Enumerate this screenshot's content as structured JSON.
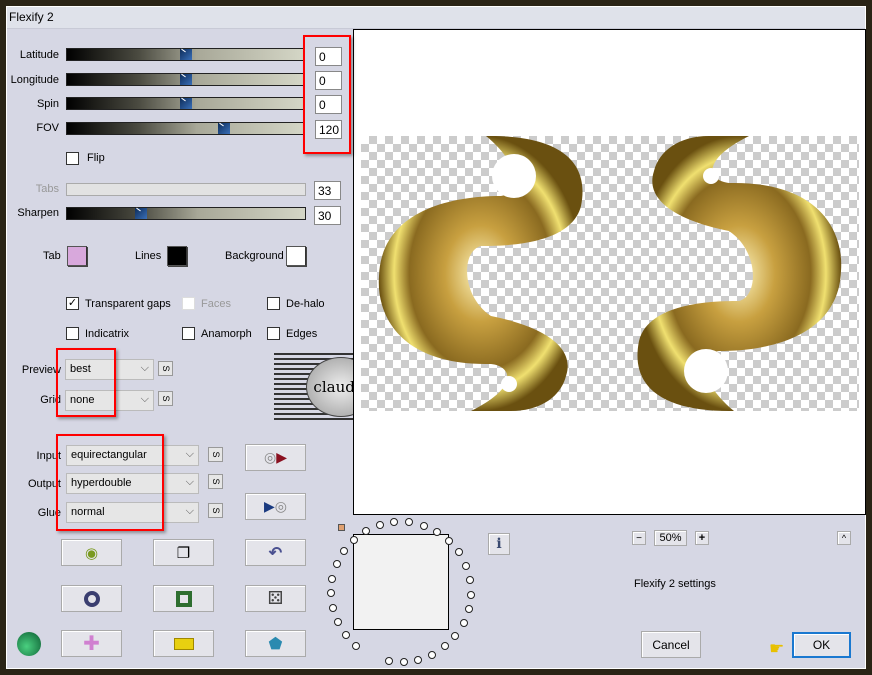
{
  "window": {
    "title": "Flexify 2"
  },
  "sliders": [
    {
      "label": "Latitude",
      "value": "0",
      "fraction": 0.5
    },
    {
      "label": "Longitude",
      "value": "0",
      "fraction": 0.5
    },
    {
      "label": "Spin",
      "value": "0",
      "fraction": 0.5
    },
    {
      "label": "FOV",
      "value": "120",
      "fraction": 0.66
    }
  ],
  "flip": {
    "label": "Flip",
    "checked": false
  },
  "tabs": {
    "label": "Tabs",
    "value": "33",
    "disabled": true
  },
  "sharpen": {
    "label": "Sharpen",
    "value": "30",
    "fraction": 0.3
  },
  "colors": {
    "tab_label": "Tab",
    "tab": "#d8a8dc",
    "lines_label": "Lines",
    "lines": "#000000",
    "background_label": "Background",
    "background": "#ffffff"
  },
  "options": {
    "transparent_gaps": {
      "label": "Transparent gaps",
      "checked": true
    },
    "faces": {
      "label": "Faces",
      "checked": false,
      "disabled": true
    },
    "dehalo": {
      "label": "De-halo",
      "checked": false
    },
    "indicatrix": {
      "label": "Indicatrix",
      "checked": false
    },
    "anamorph": {
      "label": "Anamorph",
      "checked": false
    },
    "edges": {
      "label": "Edges",
      "checked": false
    }
  },
  "preview_select": {
    "label": "Preview",
    "value": "best"
  },
  "grid_select": {
    "label": "Grid",
    "value": "none"
  },
  "input_select": {
    "label": "Input",
    "value": "equirectangular"
  },
  "output_select": {
    "label": "Output",
    "value": "hyperdouble"
  },
  "glue_select": {
    "label": "Glue",
    "value": "normal"
  },
  "s_label": "S",
  "logo_text": "claudia",
  "zoom": {
    "value": "50%",
    "minus": "−",
    "plus": "+"
  },
  "up_label": "^",
  "info_label": "i",
  "settings_text": "Flexify 2 settings",
  "cancel_label": "Cancel",
  "ok_label": "OK",
  "highlight_color": "#ff0000"
}
